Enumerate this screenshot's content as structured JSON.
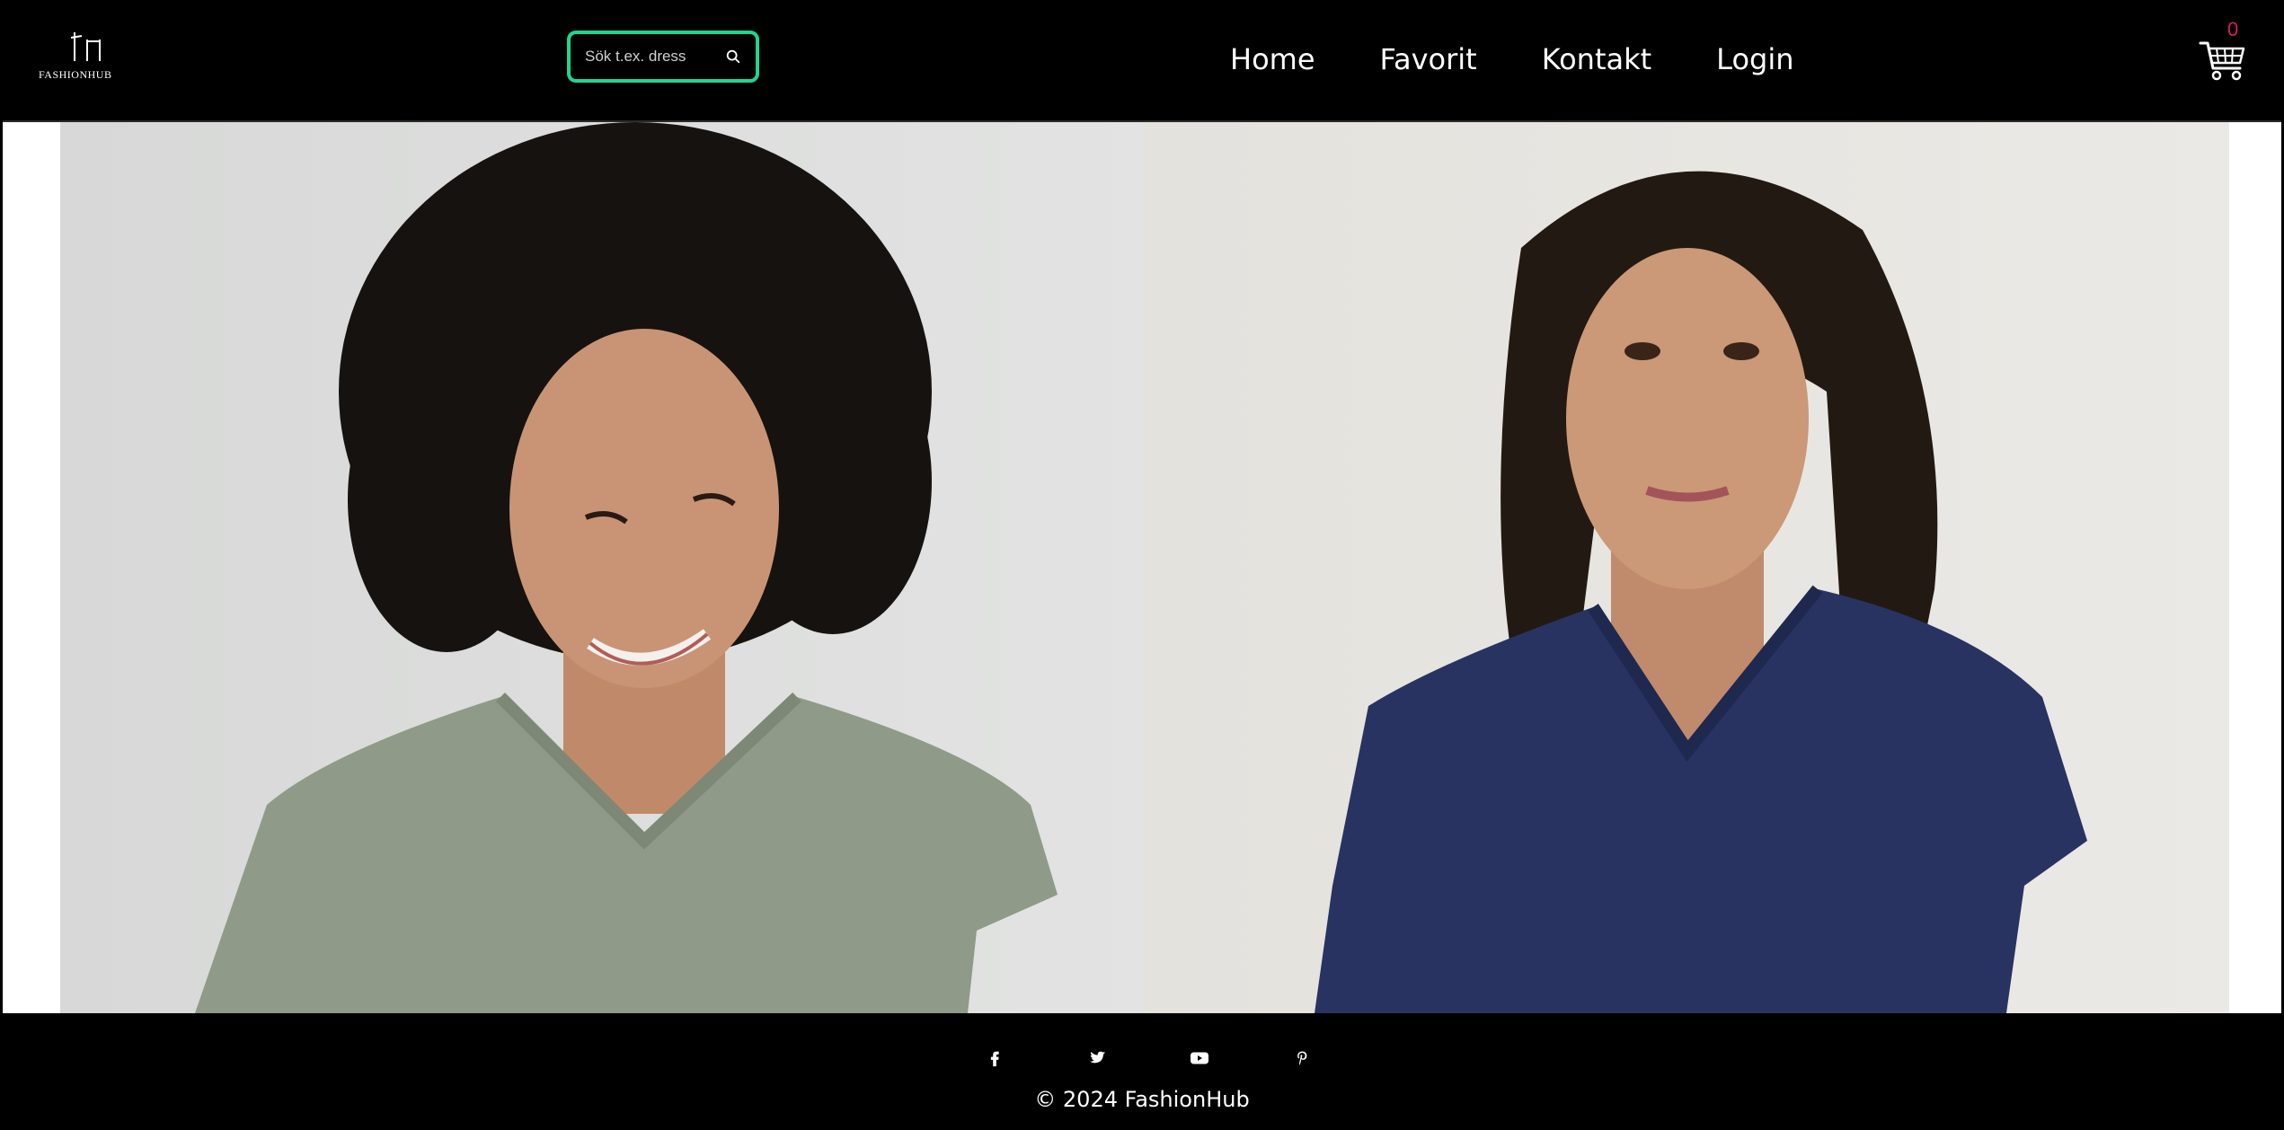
{
  "header": {
    "logo": {
      "text": "FASHIONHUB",
      "icon": "fh-monogram-icon"
    },
    "search": {
      "placeholder": "Sök t.ex. dress",
      "icon": "search-icon",
      "border_color": "#1fd68f"
    },
    "nav": [
      {
        "label": "Home"
      },
      {
        "label": "Favorit"
      },
      {
        "label": "Kontakt"
      },
      {
        "label": "Login"
      }
    ],
    "cart": {
      "count": "0",
      "icon": "shopping-cart-icon",
      "count_color": "#d81b60"
    }
  },
  "hero": {
    "images": [
      {
        "description_icon": "model-sage-green-vneck-tee"
      },
      {
        "description_icon": "model-navy-vneck-tee"
      }
    ]
  },
  "footer": {
    "social": [
      {
        "icon": "facebook-icon"
      },
      {
        "icon": "twitter-icon"
      },
      {
        "icon": "youtube-icon"
      },
      {
        "icon": "pinterest-icon"
      }
    ],
    "copyright": "© 2024 FashionHub"
  },
  "colors": {
    "header_bg": "#000000",
    "footer_bg": "#000000",
    "accent": "#1fd68f",
    "text": "#ffffff"
  }
}
